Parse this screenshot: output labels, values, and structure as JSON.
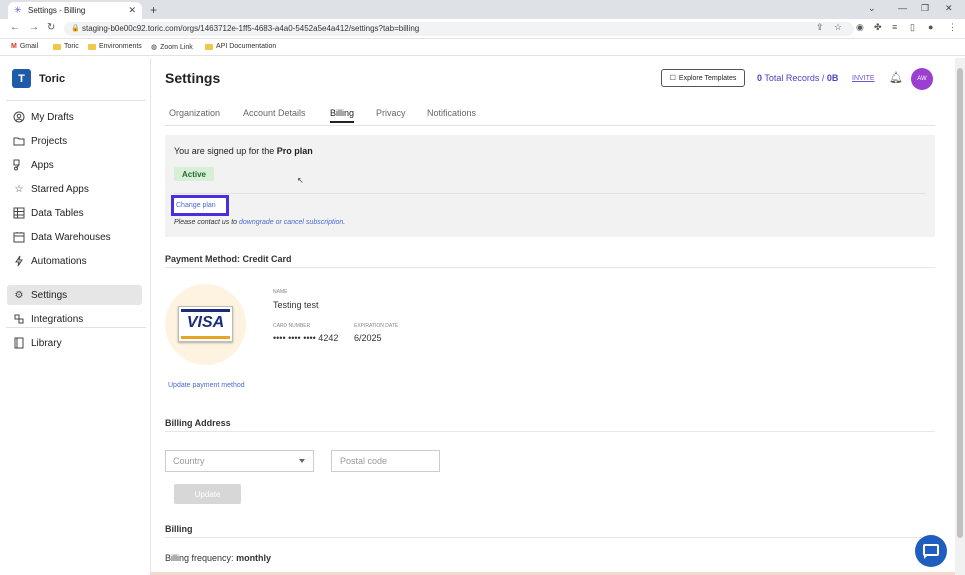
{
  "browser": {
    "tab_title": "Settings - Billing",
    "url": "staging-b0e00c92.toric.com/orgs/1463712e-1ff5-4683-a4a0-5452a5e4a412/settings?tab=billing",
    "bookmarks": [
      "Gmail",
      "Toric",
      "Environments",
      "Zoom Link",
      "API Documentation"
    ]
  },
  "sidebar": {
    "org_initial": "T",
    "org_name": "Toric",
    "items": [
      {
        "label": "My Drafts",
        "icon": "user-circle-icon"
      },
      {
        "label": "Projects",
        "icon": "folder-icon"
      },
      {
        "label": "Apps",
        "icon": "apps-icon"
      },
      {
        "label": "Starred Apps",
        "icon": "star-icon"
      },
      {
        "label": "Data Tables",
        "icon": "table-icon"
      },
      {
        "label": "Data Warehouses",
        "icon": "warehouse-icon"
      },
      {
        "label": "Automations",
        "icon": "bolt-icon"
      },
      {
        "label": "Settings",
        "icon": "gear-icon"
      },
      {
        "label": "Integrations",
        "icon": "integrations-icon"
      },
      {
        "label": "Library",
        "icon": "book-icon"
      }
    ]
  },
  "header": {
    "title": "Settings",
    "explore_label": "Explore Templates",
    "records_count": "0",
    "records_label": "Total Records /",
    "records_size": "0B",
    "invite_label": "INVITE",
    "avatar_initials": "AW"
  },
  "tabs": [
    "Organization",
    "Account Details",
    "Billing",
    "Privacy",
    "Notifications"
  ],
  "plan": {
    "prefix": "You are signed up for the",
    "plan_name": "Pro plan",
    "status": "Active",
    "change_label": "Change plan",
    "contact_prefix": "Please contact us to",
    "contact_link": "downgrade or cancel subscription",
    "contact_suffix": "."
  },
  "payment": {
    "title": "Payment Method: Credit Card",
    "brand": "VISA",
    "name_label": "NAME",
    "name_value": "Testing test",
    "card_label": "CARD NUMBER",
    "card_value": "•••• •••• •••• 4242",
    "exp_label": "EXPIRATION DATE",
    "exp_value": "6/2025",
    "update_link": "Update payment method"
  },
  "billing_address": {
    "title": "Billing Address",
    "country_placeholder": "Country",
    "postal_placeholder": "Postal code",
    "update_label": "Update"
  },
  "billing": {
    "title": "Billing",
    "freq_label": "Billing frequency:",
    "freq_value": "monthly"
  },
  "colors": {
    "accent": "#4b43c7",
    "link": "#4a6ad0",
    "highlight_border": "#4a2ee0",
    "active_badge_bg": "#d6efd6",
    "avatar": "#9b3fd1",
    "chat": "#1f5dbf"
  }
}
